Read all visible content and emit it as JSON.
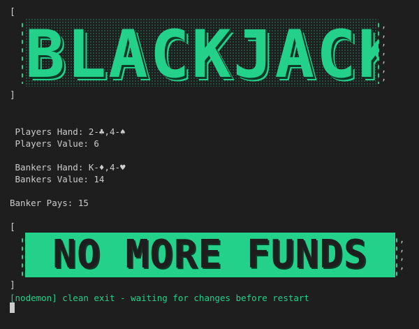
{
  "art": {
    "open_bracket": "[",
    "close_bracket": "]",
    "title_banner": "BLACKJACK",
    "funds_banner": "NO MORE FUNDS",
    "commas": ",\n,\n,\n,\n,\n,\n,"
  },
  "game": {
    "players_hand": " Players Hand: 2-♣,4-♠",
    "players_value": " Players Value: 6",
    "bankers_hand": " Bankers Hand: K-♦,4-♥",
    "bankers_value": " Bankers Value: 14",
    "banker_pays": "Banker Pays: 15"
  },
  "status": {
    "nodemon": "[nodemon] clean exit - waiting for changes before restart"
  },
  "colors": {
    "background": "#1e1e1e",
    "text": "#cccccc",
    "accent_green": "#23d18b"
  }
}
